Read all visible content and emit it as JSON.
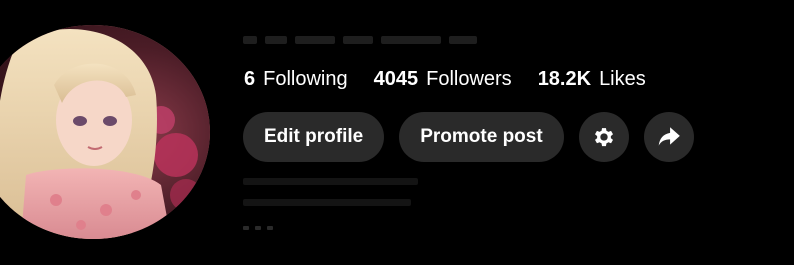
{
  "profile": {
    "stats": [
      {
        "value": "6",
        "label": "Following"
      },
      {
        "value": "4045",
        "label": "Followers"
      },
      {
        "value": "18.2K",
        "label": "Likes"
      }
    ],
    "actions": {
      "edit_label": "Edit profile",
      "promote_label": "Promote post"
    },
    "icons": {
      "settings": "gear-icon",
      "share": "share-arrow-icon"
    }
  },
  "colors": {
    "background": "#000000",
    "button_bg": "#2a2a2a",
    "text": "#ffffff"
  }
}
